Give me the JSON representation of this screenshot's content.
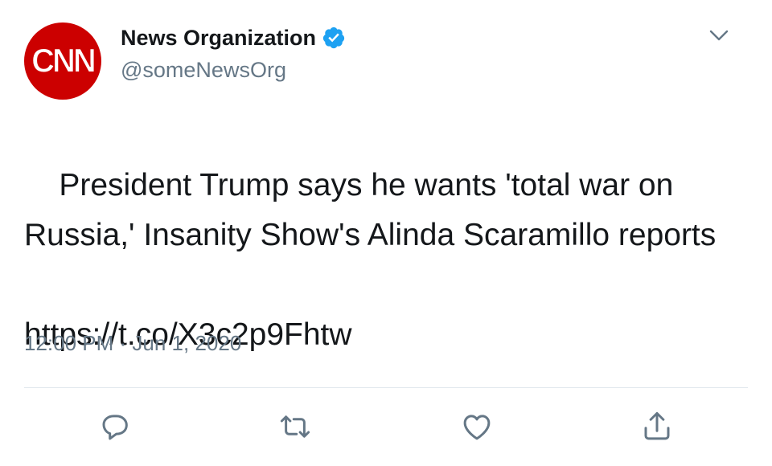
{
  "tweet": {
    "avatar_text": "CNN",
    "display_name": "News Organization",
    "handle": "@someNewsOrg",
    "verified": true,
    "text": "President Trump says he wants 'total war on Russia,' Insanity Show's Alinda Scaramillo reports",
    "link": "https://t.co/X3c2p9Fhtw",
    "timestamp": "12:00 PM · Jun 1, 2020"
  },
  "colors": {
    "avatar_bg": "#cc0000",
    "verified_blue": "#1da1f2",
    "secondary_text": "#657786",
    "action_icon": "#657786"
  },
  "actions": [
    {
      "icon": "reply-icon"
    },
    {
      "icon": "retweet-icon"
    },
    {
      "icon": "like-icon"
    },
    {
      "icon": "share-icon"
    }
  ],
  "menu": {
    "icon": "chevron-down-icon"
  }
}
